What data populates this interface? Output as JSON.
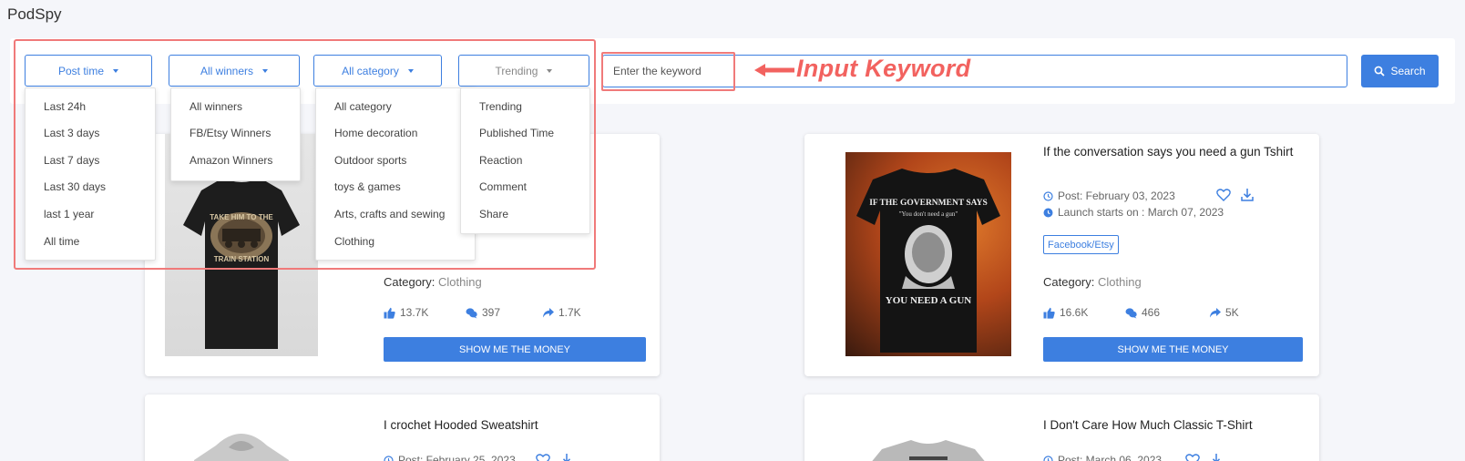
{
  "app": {
    "title": "PodSpy"
  },
  "filters": {
    "post_time": {
      "label": "Post time",
      "options": [
        "Last 24h",
        "Last 3 days",
        "Last 7 days",
        "Last 30 days",
        "last 1 year",
        "All time"
      ]
    },
    "winners": {
      "label": "All winners",
      "options": [
        "All winners",
        "FB/Etsy Winners",
        "Amazon Winners"
      ]
    },
    "category": {
      "label": "All category",
      "options": [
        "All category",
        "Home decoration",
        "Outdoor sports",
        "toys & games",
        "Arts, crafts and sewing",
        "Clothing"
      ]
    },
    "sort": {
      "label": "Trending",
      "options": [
        "Trending",
        "Published Time",
        "Reaction",
        "Comment",
        "Share"
      ]
    }
  },
  "search": {
    "placeholder": "Enter the keyword",
    "button_label": "Search"
  },
  "annotation": {
    "text": "Input Keyword"
  },
  "colors": {
    "accent": "#3d7fe0",
    "annotation": "#f2625f"
  },
  "cards": [
    {
      "image_text": [
        "TAKE HIM TO THE",
        "TRAIN STATION"
      ],
      "category_label": "Category:",
      "category": "Clothing",
      "likes": "13.7K",
      "comments": "397",
      "shares": "1.7K",
      "cta": "SHOW ME THE MONEY"
    },
    {
      "title": "If the conversation says you need a gun Tshirt",
      "post_date": "Post: February 03, 2023",
      "launch": "Launch starts on : March 07, 2023",
      "badge": "Facebook/Etsy",
      "image_text": [
        "IF THE GOVERNMENT SAYS",
        "\"You don't need a gun\"",
        "YOU NEED A GUN"
      ],
      "category_label": "Category:",
      "category": "Clothing",
      "likes": "16.6K",
      "comments": "466",
      "shares": "5K",
      "cta": "SHOW ME THE MONEY"
    },
    {
      "title": "I crochet Hooded Sweatshirt",
      "post_date": "Post: February 25, 2023"
    },
    {
      "title": "I Don't Care How Much Classic T-Shirt",
      "post_date": "Post: March 06, 2023"
    }
  ]
}
